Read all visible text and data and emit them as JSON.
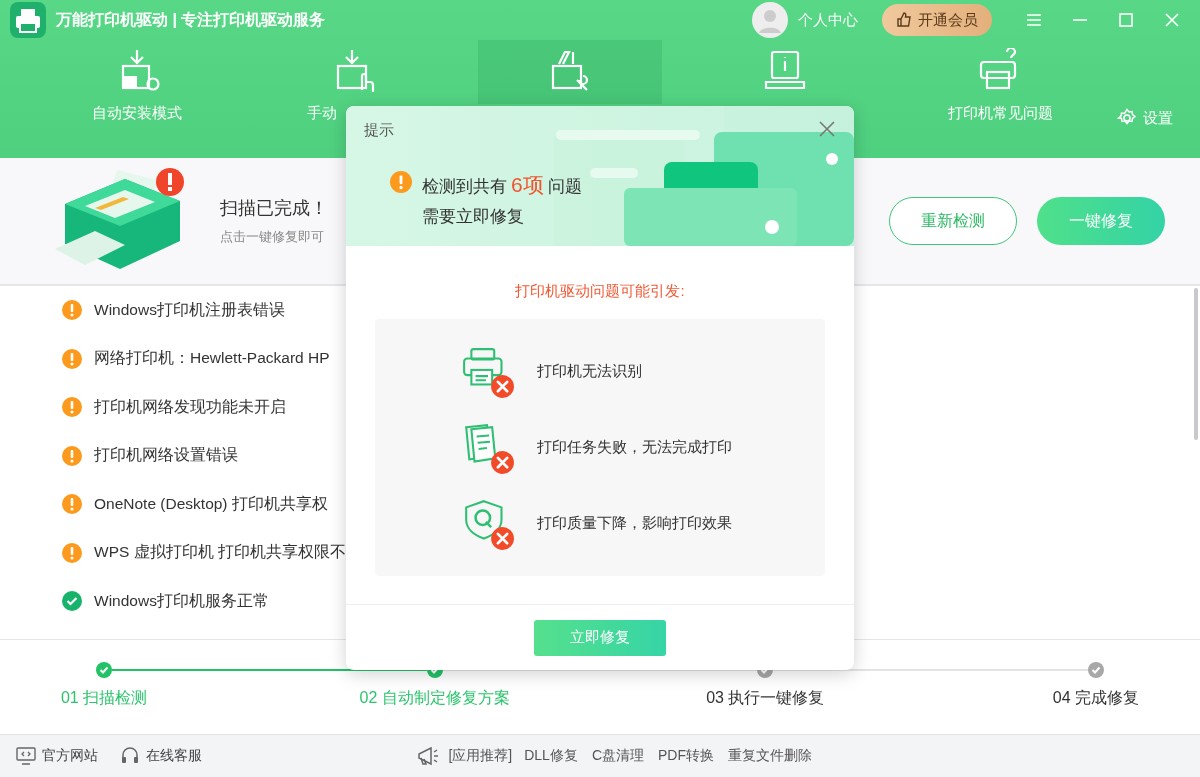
{
  "window": {
    "title": "万能打印机驱动 | 专注打印机驱动服务",
    "user": "个人中心",
    "vip_button": "开通会员"
  },
  "nav": {
    "tabs": [
      {
        "label": "自动安装模式",
        "selected": false
      },
      {
        "label": "手动",
        "selected": false
      },
      {
        "selected": true
      },
      {
        "selected": false
      },
      {
        "label": "打印机常见问题",
        "selected": false
      }
    ],
    "settings": "设置"
  },
  "summary": {
    "title": "扫描已完成！",
    "subtitle": "点击一键修复即可",
    "buttons": [
      {
        "label": "重新检测",
        "kind": "outline"
      },
      {
        "label": "一键修复",
        "kind": "primary"
      }
    ]
  },
  "results": [
    {
      "kind": "warning",
      "text": "Windows打印机注册表错误"
    },
    {
      "kind": "warning",
      "text": "网络打印机：Hewlett-Packard HP"
    },
    {
      "kind": "warning",
      "text": "打印机网络发现功能未开启"
    },
    {
      "kind": "warning",
      "text": "打印机网络设置错误"
    },
    {
      "kind": "warning",
      "text": "OneNote (Desktop) 打印机共享权"
    },
    {
      "kind": "warning",
      "text": "WPS 虚拟打印机 打印机共享权限不"
    },
    {
      "kind": "ok",
      "text": "Windows打印机服务正常"
    }
  ],
  "steps": [
    {
      "label": "01 扫描检测",
      "done": true
    },
    {
      "label": "02 自动制定修复方案",
      "done": true
    },
    {
      "label": "03 执行一键修复",
      "done": false
    },
    {
      "label": "04 完成修复",
      "done": false
    }
  ],
  "footer": {
    "links": [
      "官方网站",
      "在线客服"
    ],
    "recommend_label": "[应用推荐]",
    "apps": [
      "DLL修复",
      "C盘清理",
      "PDF转换",
      "重复文件删除"
    ]
  },
  "dialog": {
    "title": "提示",
    "headline": {
      "prefix": "检测到共有",
      "count": "6项",
      "suffix": "问题",
      "line2": "需要立即修复"
    },
    "subtitle": "打印机驱动问题可能引发:",
    "issues": [
      "打印机无法识别",
      "打印任务失败，无法完成打印",
      "打印质量下降，影响打印效果"
    ],
    "button": "立即修复"
  }
}
